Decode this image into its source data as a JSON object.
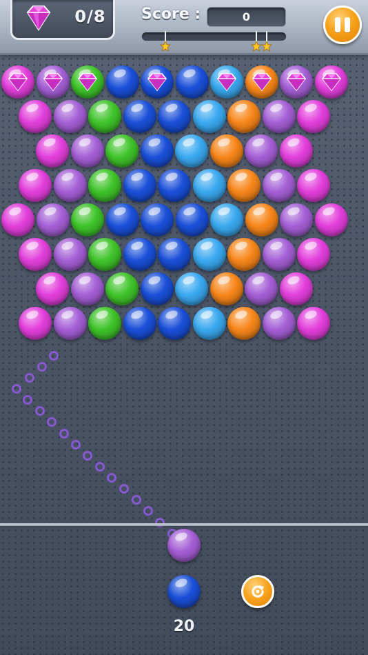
{
  "hud": {
    "gems_collected": "0/8",
    "score_label": "Score :",
    "score_value": "0",
    "progress": 0,
    "star_thresholds": 3
  },
  "colors": {
    "magenta": "#e33fdc",
    "purple": "#a55fd6",
    "green": "#3fc42a",
    "blue": "#1a4fd8",
    "cyan": "#3aa9f0",
    "orange": "#f7861a",
    "gem": "#e640d9"
  },
  "board": {
    "rows": [
      [
        {
          "c": "magenta",
          "gem": true
        },
        {
          "c": "purple",
          "gem": true
        },
        {
          "c": "green",
          "gem": true
        },
        {
          "c": "blue",
          "gem": false
        },
        {
          "c": "blue",
          "gem": true
        },
        {
          "c": "blue",
          "gem": false
        },
        {
          "c": "cyan",
          "gem": true
        },
        {
          "c": "orange",
          "gem": true
        },
        {
          "c": "purple",
          "gem": true
        },
        {
          "c": "magenta",
          "gem": true
        }
      ],
      [
        {
          "c": "magenta"
        },
        {
          "c": "purple"
        },
        {
          "c": "green"
        },
        {
          "c": "blue"
        },
        {
          "c": "blue"
        },
        {
          "c": "cyan"
        },
        {
          "c": "orange"
        },
        {
          "c": "purple"
        },
        {
          "c": "magenta"
        }
      ],
      [
        {
          "c": "magenta"
        },
        {
          "c": "purple"
        },
        {
          "c": "green"
        },
        {
          "c": "blue"
        },
        {
          "c": "cyan"
        },
        {
          "c": "orange"
        },
        {
          "c": "purple"
        },
        {
          "c": "magenta"
        }
      ],
      [
        {
          "c": "magenta"
        },
        {
          "c": "purple"
        },
        {
          "c": "green"
        },
        {
          "c": "blue"
        },
        {
          "c": "blue"
        },
        {
          "c": "cyan"
        },
        {
          "c": "orange"
        },
        {
          "c": "purple"
        },
        {
          "c": "magenta"
        }
      ],
      [
        {
          "c": "magenta"
        },
        {
          "c": "purple"
        },
        {
          "c": "green"
        },
        {
          "c": "blue"
        },
        {
          "c": "blue"
        },
        {
          "c": "blue"
        },
        {
          "c": "cyan"
        },
        {
          "c": "orange"
        },
        {
          "c": "purple"
        },
        {
          "c": "magenta"
        }
      ],
      [
        {
          "c": "magenta"
        },
        {
          "c": "purple"
        },
        {
          "c": "green"
        },
        {
          "c": "blue"
        },
        {
          "c": "blue"
        },
        {
          "c": "cyan"
        },
        {
          "c": "orange"
        },
        {
          "c": "purple"
        },
        {
          "c": "magenta"
        }
      ],
      [
        {
          "c": "magenta"
        },
        {
          "c": "purple"
        },
        {
          "c": "green"
        },
        {
          "c": "blue"
        },
        {
          "c": "cyan"
        },
        {
          "c": "orange"
        },
        {
          "c": "purple"
        },
        {
          "c": "magenta"
        }
      ],
      [
        {
          "c": "magenta"
        },
        {
          "c": "purple"
        },
        {
          "c": "green"
        },
        {
          "c": "blue"
        },
        {
          "c": "blue"
        },
        {
          "c": "cyan"
        },
        {
          "c": "orange"
        },
        {
          "c": "purple"
        },
        {
          "c": "magenta"
        }
      ]
    ]
  },
  "shooter": {
    "current_color": "purple",
    "next_color": "blue",
    "shots_left": "20"
  },
  "icons": {
    "gem": "gem-icon",
    "pause": "pause-icon",
    "swap": "swap-icon",
    "star": "star-icon"
  }
}
